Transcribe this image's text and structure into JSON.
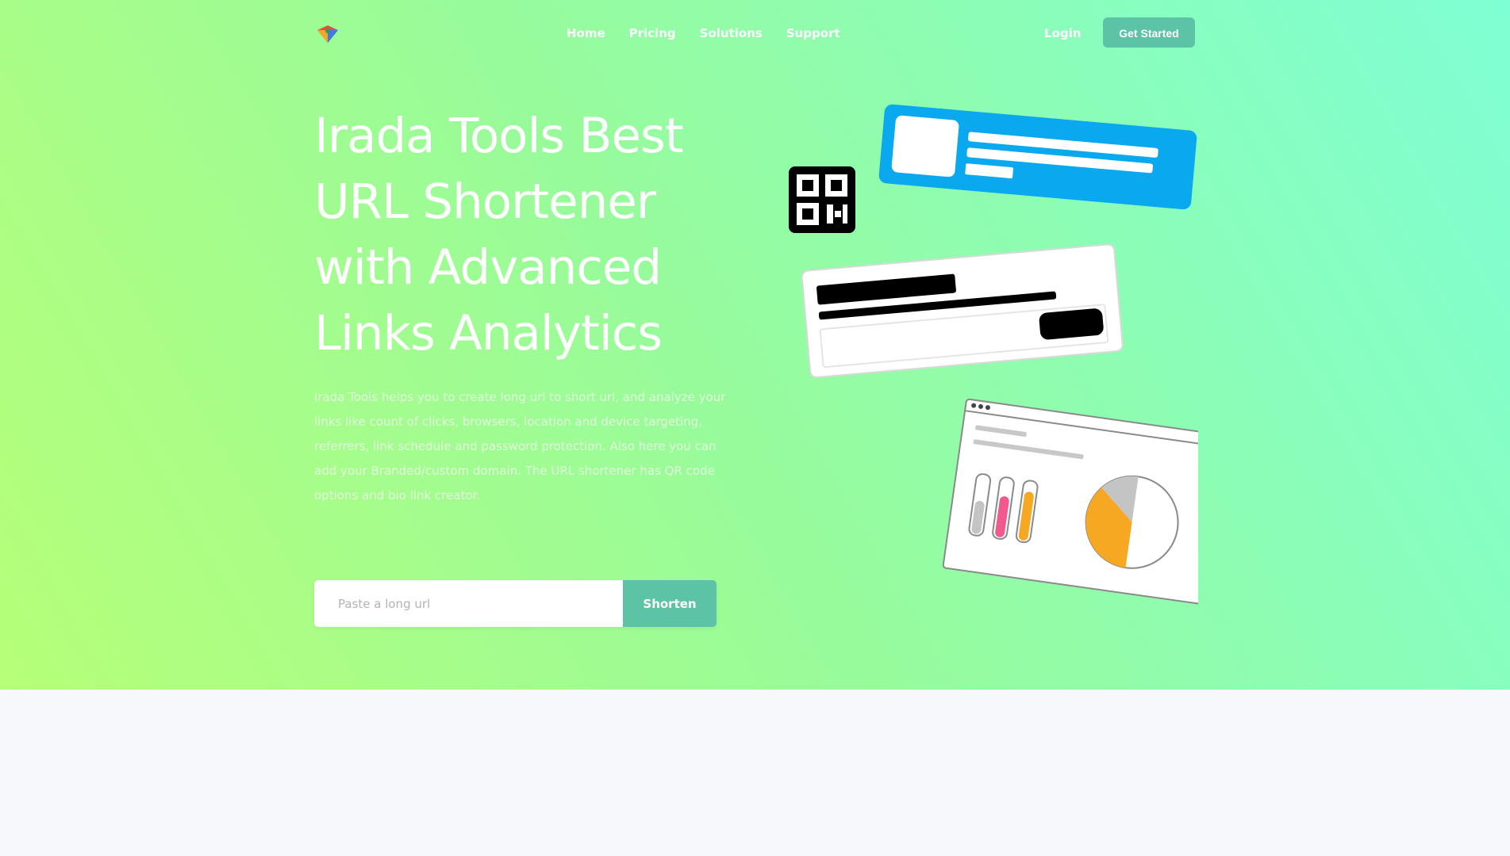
{
  "nav": {
    "items": [
      {
        "label": "Home"
      },
      {
        "label": "Pricing"
      },
      {
        "label": "Solutions"
      },
      {
        "label": "Support"
      }
    ],
    "login_label": "Login",
    "get_started_label": "Get Started"
  },
  "hero": {
    "title": "Irada Tools Best URL Shortener with Advanced Links Analytics",
    "description": "Irada Tools helps you to create long url to short url, and analyze your links like count of clicks, browsers, location and device targeting, referrers, link schedule and password protection. Also here you can add your Branded/custom domain. The URL shortener has QR code options and bio link creator.",
    "url_input_placeholder": "Paste a long url",
    "shorten_label": "Shorten"
  },
  "colors": {
    "accent": "#5cc3a7",
    "card_blue": "#0aa9ef",
    "chart_orange": "#f7a823",
    "chart_pink": "#f05a8a",
    "chart_grey": "#c4c4c4"
  },
  "icons": [
    "logo-icon",
    "qr-code-icon",
    "profile-card-illustration",
    "form-card-illustration",
    "analytics-card-illustration"
  ]
}
